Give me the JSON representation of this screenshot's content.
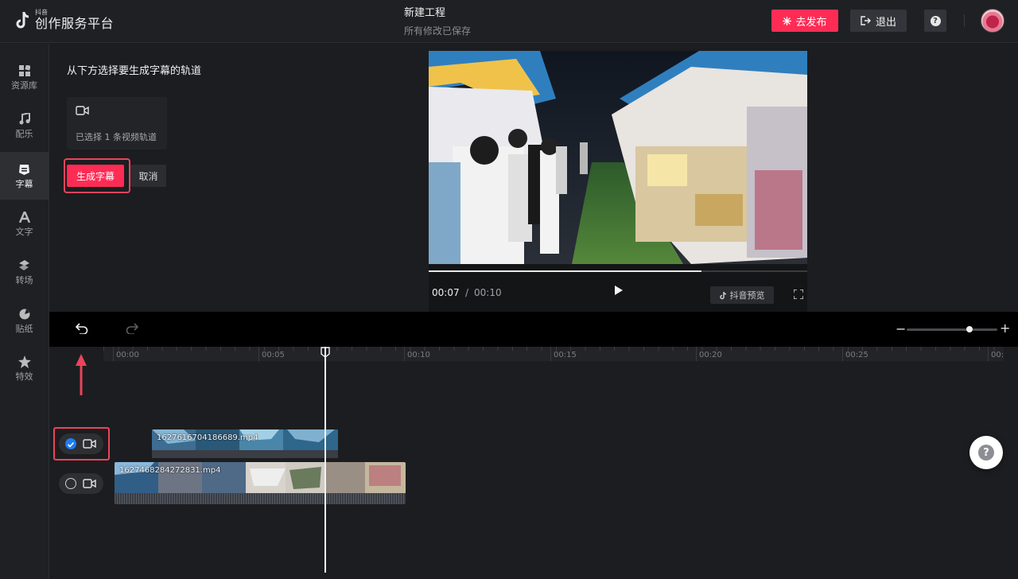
{
  "header": {
    "logo_small": "抖音",
    "logo_main": "创作服务平台",
    "project_title": "新建工程",
    "save_status": "所有修改已保存",
    "publish_label": "去发布",
    "exit_label": "退出",
    "help_glyph": "?"
  },
  "sidebar": {
    "items": [
      {
        "label": "资源库",
        "icon": "grid-icon"
      },
      {
        "label": "配乐",
        "icon": "music-icon"
      },
      {
        "label": "字幕",
        "icon": "subtitle-icon",
        "active": true
      },
      {
        "label": "文字",
        "icon": "text-icon"
      },
      {
        "label": "转场",
        "icon": "transition-icon"
      },
      {
        "label": "贴纸",
        "icon": "sticker-icon"
      },
      {
        "label": "特效",
        "icon": "star-icon"
      }
    ]
  },
  "panel": {
    "title": "从下方选择要生成字幕的轨道",
    "selected_text": "已选择 1 条视频轨道",
    "generate_label": "生成字幕",
    "cancel_label": "取消"
  },
  "preview": {
    "current_time": "00:07",
    "separator": "/",
    "total_time": "00:10",
    "progress": 0.72,
    "douyin_preview_label": "抖音预览"
  },
  "timeline": {
    "ticks": [
      "00:00",
      "00:05",
      "00:10",
      "00:15",
      "00:20",
      "00:25",
      "00:"
    ],
    "tracks": [
      {
        "checked": true,
        "clip_name": "1627616704186689.mp4"
      },
      {
        "checked": false,
        "clip_name": "1627468284272831.mp4"
      }
    ],
    "zoom_level": 0.67
  },
  "colors": {
    "accent": "#fe2c55",
    "highlight": "#e9455b",
    "check_blue": "#1e7cf2"
  },
  "float_help_glyph": "?"
}
